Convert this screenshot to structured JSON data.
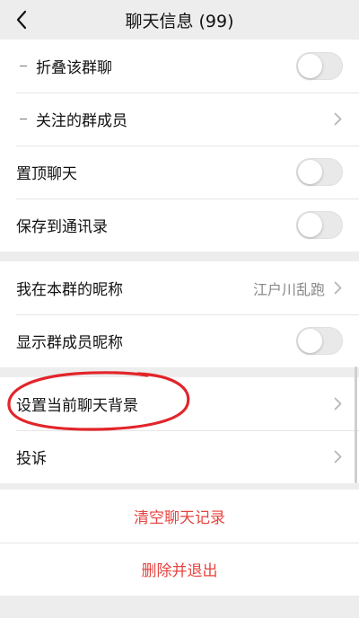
{
  "navbar": {
    "title": "聊天信息 (99)"
  },
  "section1": {
    "fold_group": "折叠该群聊",
    "followed_members": "关注的群成员",
    "pin_chat": "置顶聊天",
    "save_to_contacts": "保存到通讯录"
  },
  "section2": {
    "my_nickname_label": "我在本群的昵称",
    "my_nickname_value": "江户川乱跑",
    "show_member_nicknames": "显示群成员昵称"
  },
  "section3": {
    "set_chat_background": "设置当前聊天背景",
    "complain": "投诉"
  },
  "actions": {
    "clear_history": "清空聊天记录",
    "delete_and_exit": "删除并退出"
  },
  "colors": {
    "danger": "#e64340",
    "annotation": "#e2252a"
  },
  "toggles": {
    "fold_group": false,
    "pin_chat": false,
    "save_to_contacts": false,
    "show_member_nicknames": false
  }
}
